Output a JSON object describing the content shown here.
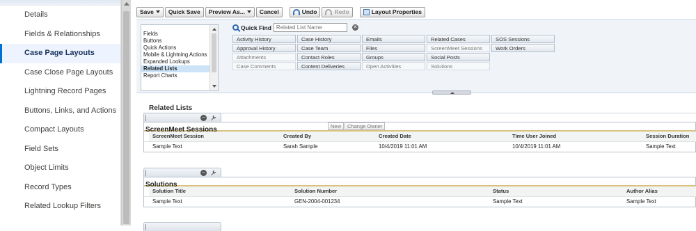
{
  "nav": {
    "items": [
      {
        "label": "Details"
      },
      {
        "label": "Fields & Relationships"
      },
      {
        "label": "Case Page Layouts",
        "active": true
      },
      {
        "label": "Case Close Page Layouts"
      },
      {
        "label": "Lightning Record Pages"
      },
      {
        "label": "Buttons, Links, and Actions"
      },
      {
        "label": "Compact Layouts"
      },
      {
        "label": "Field Sets"
      },
      {
        "label": "Object Limits"
      },
      {
        "label": "Record Types"
      },
      {
        "label": "Related Lookup Filters"
      }
    ]
  },
  "toolbar": {
    "save": "Save",
    "quick_save": "Quick Save",
    "preview_as": "Preview As...",
    "cancel": "Cancel",
    "undo": "Undo",
    "redo": "Redo",
    "layout_properties": "Layout Properties"
  },
  "palette": {
    "categories": [
      "Fields",
      "Buttons",
      "Quick Actions",
      "Mobile & Lightning Actions",
      "Expanded Lookups",
      "Related Lists",
      "Report Charts"
    ],
    "selected_category": "Related Lists",
    "quick_find": {
      "label": "Quick Find",
      "placeholder": "Related List Name"
    },
    "items": [
      {
        "label": "Activity History",
        "used": false
      },
      {
        "label": "Case History",
        "used": false
      },
      {
        "label": "Emails",
        "used": false
      },
      {
        "label": "Related Cases",
        "used": false
      },
      {
        "label": "SOS Sessions",
        "used": false
      },
      {
        "label": "Approval History",
        "used": false
      },
      {
        "label": "Case Team",
        "used": false
      },
      {
        "label": "Files",
        "used": false
      },
      {
        "label": "ScreenMeet Sessions",
        "used": true
      },
      {
        "label": "Work Orders",
        "used": false
      },
      {
        "label": "Attachments",
        "used": true
      },
      {
        "label": "Contact Roles",
        "used": false
      },
      {
        "label": "Groups",
        "used": false
      },
      {
        "label": "Social Posts",
        "used": false
      },
      {
        "label": "",
        "used": false
      },
      {
        "label": "Case Comments",
        "used": true
      },
      {
        "label": "Content Deliveries",
        "used": false
      },
      {
        "label": "Open Activities",
        "used": true
      },
      {
        "label": "Solutions",
        "used": true
      },
      {
        "label": "",
        "used": false
      }
    ]
  },
  "related_lists": {
    "heading": "Related Lists",
    "lists": [
      {
        "title": "ScreenMeet Sessions",
        "buttons": [
          "New",
          "Change Owner"
        ],
        "columns": [
          "ScreenMeet Session",
          "Created By",
          "Created Date",
          "Time User Joined",
          "Session Duration"
        ],
        "row": [
          "Sample Text",
          "Sarah Sample",
          "10/4/2019 11:01 AM",
          "10/4/2019 11:01 AM",
          "Sample Text"
        ]
      },
      {
        "title": "Solutions",
        "buttons": [],
        "columns": [
          "Solution Title",
          "Solution Number",
          "Status",
          "Author Alias"
        ],
        "row": [
          "Sample Text",
          "GEN-2004-001234",
          "Sample Text",
          "Sample Text"
        ]
      }
    ]
  }
}
